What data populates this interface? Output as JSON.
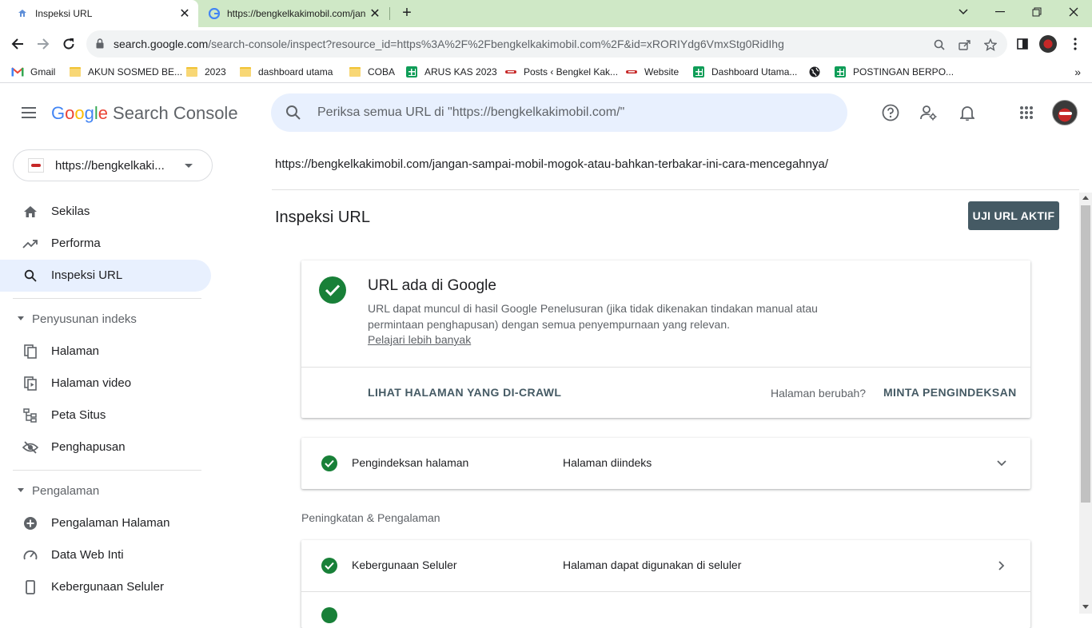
{
  "browser": {
    "tabs": [
      {
        "title": "Inspeksi URL",
        "active": true
      },
      {
        "title": "https://bengkelkakimobil.com/jan",
        "active": false
      }
    ],
    "address": {
      "host": "search.google.com",
      "path": "/search-console/inspect?resource_id=https%3A%2F%2Fbengkelkakimobil.com%2F&id=xRORIYdg6VmxStg0RidIhg"
    },
    "bookmarks": [
      {
        "label": "Gmail",
        "icon": "gmail-icon"
      },
      {
        "label": "AKUN SOSMED BE...",
        "icon": "folder-icon"
      },
      {
        "label": "2023",
        "icon": "folder-icon"
      },
      {
        "label": "dashboard utama",
        "icon": "folder-icon"
      },
      {
        "label": "COBA",
        "icon": "folder-icon"
      },
      {
        "label": "ARUS KAS 2023",
        "icon": "sheets-icon"
      },
      {
        "label": "Posts ‹ Bengkel Kak...",
        "icon": "site-icon"
      },
      {
        "label": "Website",
        "icon": "site-icon"
      },
      {
        "label": "Dashboard Utama...",
        "icon": "sheets-icon"
      },
      {
        "label": "",
        "icon": "globe-icon"
      },
      {
        "label": "POSTINGAN BERPO...",
        "icon": "sheets-icon"
      }
    ]
  },
  "header": {
    "logo_google": [
      "G",
      "o",
      "o",
      "g",
      "l",
      "e"
    ],
    "product": "Search Console",
    "search_placeholder": "Periksa semua URL di \"https://bengkelkakimobil.com/\""
  },
  "sidebar": {
    "property": "https://bengkelkaki...",
    "items": [
      {
        "label": "Sekilas",
        "icon": "home-icon"
      },
      {
        "label": "Performa",
        "icon": "trending-icon"
      },
      {
        "label": "Inspeksi URL",
        "icon": "search-icon",
        "active": true
      }
    ],
    "section_index": "Penyusunan indeks",
    "index_items": [
      {
        "label": "Halaman",
        "icon": "pages-icon"
      },
      {
        "label": "Halaman video",
        "icon": "video-page-icon"
      },
      {
        "label": "Peta Situs",
        "icon": "sitemap-icon"
      },
      {
        "label": "Penghapusan",
        "icon": "removal-icon"
      }
    ],
    "section_experience": "Pengalaman",
    "experience_items": [
      {
        "label": "Pengalaman Halaman",
        "icon": "plus-circle-icon"
      },
      {
        "label": "Data Web Inti",
        "icon": "gauge-icon"
      },
      {
        "label": "Kebergunaan Seluler",
        "icon": "phone-icon"
      }
    ]
  },
  "main": {
    "inspected_url": "https://bengkelkakimobil.com/jangan-sampai-mobil-mogok-atau-bahkan-terbakar-ini-cara-mencegahnya/",
    "title": "Inspeksi URL",
    "live_test_button": "UJI URL AKTIF",
    "status_card": {
      "title": "URL ada di Google",
      "description": "URL dapat muncul di hasil Google Penelusuran (jika tidak dikenakan tindakan manual atau permintaan penghapusan) dengan semua penyempurnaan yang relevan.",
      "learn_more": "Pelajari lebih banyak",
      "crawl_button": "LIHAT HALAMAN YANG DI-CRAWL",
      "changed_question": "Halaman berubah?",
      "request_button": "MINTA PENGINDEKSAN"
    },
    "indexing_row": {
      "label": "Pengindeksan halaman",
      "value": "Halaman diindeks"
    },
    "enhancements_heading": "Peningkatan & Pengalaman",
    "mobile_row": {
      "label": "Kebergunaan Seluler",
      "value": "Halaman dapat digunakan di seluler"
    }
  },
  "colors": {
    "tabstrip": "#cfe8c6",
    "accent_blue_light": "#e8f0fe",
    "success_green": "#188038",
    "button_slate": "#455a64"
  }
}
